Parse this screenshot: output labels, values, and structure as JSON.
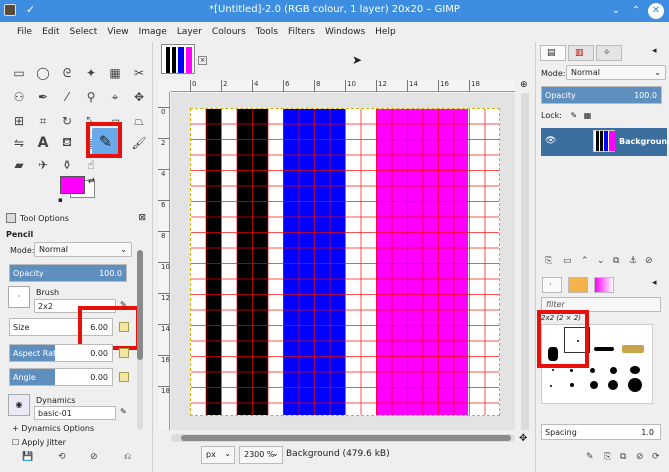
{
  "window": {
    "title": "*[Untitled]-2.0 (RGB colour, 1 layer) 20x20 – GIMP"
  },
  "menu": [
    "File",
    "Edit",
    "Select",
    "View",
    "Image",
    "Layer",
    "Colours",
    "Tools",
    "Filters",
    "Windows",
    "Help"
  ],
  "toolbox": {
    "active_tool": "pencil-tool",
    "fg_color": "#ff00ff",
    "bg_color": "#ffffff"
  },
  "tool_options": {
    "tab_label": "Tool Options",
    "tool_name": "Pencil",
    "mode_label": "Mode:",
    "mode_value": "Normal",
    "opacity_label": "Opacity",
    "opacity_value": "100.0",
    "brush_label": "Brush",
    "brush_value": "2x2",
    "size_label": "Size",
    "size_value": "6.00",
    "aspect_label": "Aspect Ratio",
    "aspect_value": "0.00",
    "angle_label": "Angle",
    "angle_value": "0.00",
    "dynamics_label": "Dynamics",
    "dynamics_value": "basic-01",
    "dynamics_options_label": "+ Dynamics Options",
    "apply_jitter_label": "Apply Jitter"
  },
  "canvas": {
    "ruler_h_labels": [
      "0",
      "2",
      "4",
      "6",
      "8",
      "10",
      "12",
      "14",
      "16",
      "18"
    ],
    "ruler_v_labels": [
      "0",
      "2",
      "4",
      "6",
      "8",
      "10",
      "12",
      "14",
      "16",
      "18"
    ],
    "stripe_colors": [
      "#000000",
      "#0000ff",
      "#ff00ff"
    ]
  },
  "status": {
    "unit": "px",
    "zoom": "2300 %",
    "info": "Background (479.6 kB)"
  },
  "layers": {
    "mode_label": "Mode:",
    "mode_value": "Normal",
    "opacity_label": "Opacity",
    "opacity_value": "100.0",
    "lock_label": "Lock:",
    "layer_name": "Background"
  },
  "brushes": {
    "filter_placeholder": "filter",
    "selected_name": "2x2 (2 × 2)",
    "spacing_label": "Spacing",
    "spacing_value": "1.0"
  }
}
